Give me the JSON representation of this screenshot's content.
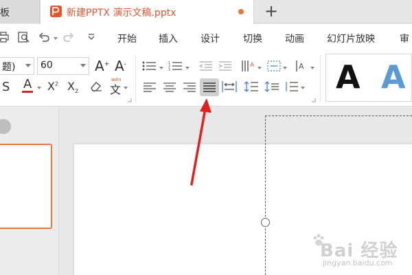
{
  "tabs": {
    "left_label": "板",
    "active_title": "新建PPTX 演示文稿.pptx",
    "new_tab": "+"
  },
  "menu": {
    "items": [
      "开始",
      "插入",
      "设计",
      "切换",
      "动画",
      "幻灯片放映",
      "审"
    ]
  },
  "ribbon": {
    "font_name": "题)",
    "font_size": "60",
    "font_grow": "A",
    "font_shrink": "A",
    "pinyin": "文",
    "styles_sample": [
      "A",
      "A"
    ]
  },
  "watermark": {
    "brand": "Bai 经验",
    "url": "jingyan.baidu.com"
  },
  "colors": {
    "accent": "#e8542e",
    "arrow": "#e0201e",
    "style_blue": "#5b9bd5"
  }
}
